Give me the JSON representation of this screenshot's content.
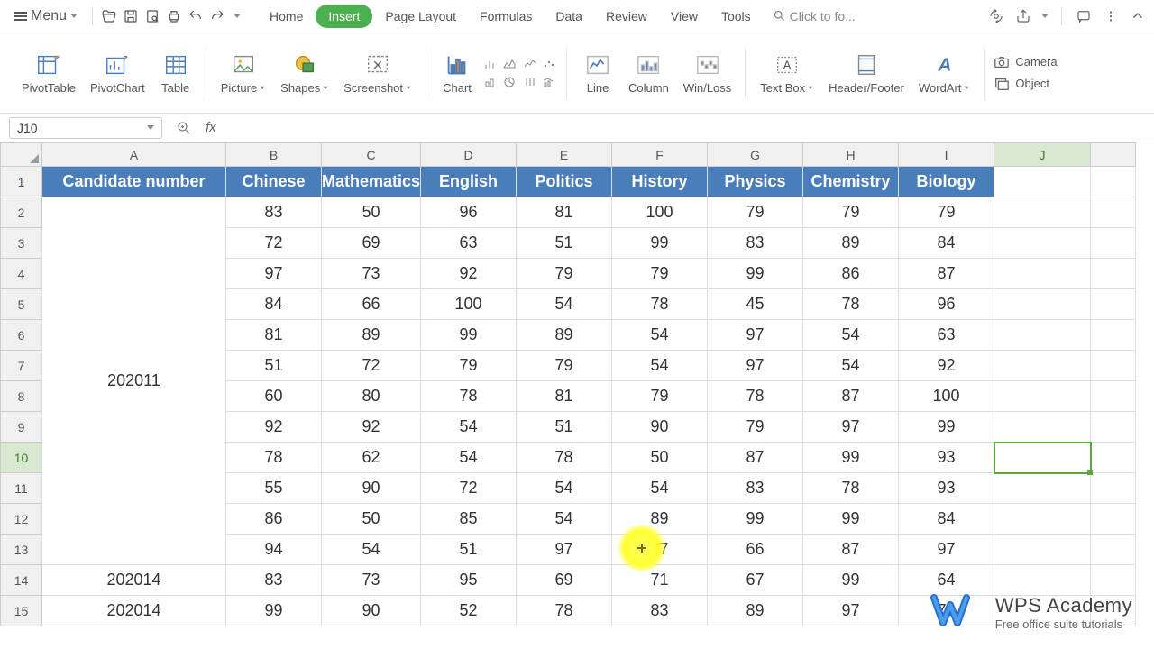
{
  "menu": {
    "label": "Menu"
  },
  "tabs": [
    "Home",
    "Insert",
    "Page Layout",
    "Formulas",
    "Data",
    "Review",
    "View",
    "Tools"
  ],
  "active_tab_index": 1,
  "search_placeholder": "Click to fo...",
  "ribbon": {
    "pivottable": "PivotTable",
    "pivotchart": "PivotChart",
    "table": "Table",
    "picture": "Picture",
    "shapes": "Shapes",
    "screenshot": "Screenshot",
    "chart": "Chart",
    "line": "Line",
    "column": "Column",
    "winloss": "Win/Loss",
    "textbox": "Text Box",
    "headerfooter": "Header/Footer",
    "wordart": "WordArt",
    "camera": "Camera",
    "object": "Object"
  },
  "namebox": "J10",
  "formula": "",
  "columns": [
    "A",
    "B",
    "C",
    "D",
    "E",
    "F",
    "G",
    "H",
    "I",
    "J",
    ""
  ],
  "headers": [
    "Candidate number",
    "Chinese",
    "Mathematics",
    "English",
    "Politics",
    "History",
    "Physics",
    "Chemistry",
    "Biology"
  ],
  "merged_candidate": "202011",
  "rows": [
    [
      "",
      "83",
      "50",
      "96",
      "81",
      "100",
      "79",
      "79",
      "79"
    ],
    [
      "",
      "72",
      "69",
      "63",
      "51",
      "99",
      "83",
      "89",
      "84"
    ],
    [
      "",
      "97",
      "73",
      "92",
      "79",
      "79",
      "99",
      "86",
      "87"
    ],
    [
      "",
      "84",
      "66",
      "100",
      "54",
      "78",
      "45",
      "78",
      "96"
    ],
    [
      "",
      "81",
      "89",
      "99",
      "89",
      "54",
      "97",
      "54",
      "63"
    ],
    [
      "",
      "51",
      "72",
      "79",
      "79",
      "54",
      "97",
      "54",
      "92"
    ],
    [
      "",
      "60",
      "80",
      "78",
      "81",
      "79",
      "78",
      "87",
      "100"
    ],
    [
      "",
      "92",
      "92",
      "54",
      "51",
      "90",
      "79",
      "97",
      "99"
    ],
    [
      "",
      "78",
      "62",
      "54",
      "78",
      "50",
      "87",
      "99",
      "93"
    ],
    [
      "",
      "55",
      "90",
      "72",
      "54",
      "54",
      "83",
      "78",
      "93"
    ],
    [
      "",
      "86",
      "50",
      "85",
      "54",
      "89",
      "99",
      "99",
      "84"
    ],
    [
      "",
      "94",
      "54",
      "51",
      "97",
      "97",
      "66",
      "87",
      "97"
    ],
    [
      "202014",
      "83",
      "73",
      "95",
      "69",
      "71",
      "67",
      "99",
      "64"
    ],
    [
      "202014",
      "99",
      "90",
      "52",
      "78",
      "83",
      "89",
      "97",
      "78"
    ]
  ],
  "row_labels": [
    "1",
    "2",
    "3",
    "4",
    "5",
    "6",
    "7",
    "8",
    "9",
    "10",
    "11",
    "12",
    "13",
    "14",
    "15"
  ],
  "selected": {
    "row": 10,
    "col": "J"
  },
  "watermark": {
    "title": "WPS Academy",
    "subtitle": "Free office suite tutorials"
  },
  "chart_data": {
    "type": "table",
    "title": "",
    "columns": [
      "Candidate number",
      "Chinese",
      "Mathematics",
      "English",
      "Politics",
      "History",
      "Physics",
      "Chemistry",
      "Biology"
    ],
    "records": [
      {
        "Candidate number": "202011",
        "Chinese": 83,
        "Mathematics": 50,
        "English": 96,
        "Politics": 81,
        "History": 100,
        "Physics": 79,
        "Chemistry": 79,
        "Biology": 79
      },
      {
        "Candidate number": "202011",
        "Chinese": 72,
        "Mathematics": 69,
        "English": 63,
        "Politics": 51,
        "History": 99,
        "Physics": 83,
        "Chemistry": 89,
        "Biology": 84
      },
      {
        "Candidate number": "202011",
        "Chinese": 97,
        "Mathematics": 73,
        "English": 92,
        "Politics": 79,
        "History": 79,
        "Physics": 99,
        "Chemistry": 86,
        "Biology": 87
      },
      {
        "Candidate number": "202011",
        "Chinese": 84,
        "Mathematics": 66,
        "English": 100,
        "Politics": 54,
        "History": 78,
        "Physics": 45,
        "Chemistry": 78,
        "Biology": 96
      },
      {
        "Candidate number": "202011",
        "Chinese": 81,
        "Mathematics": 89,
        "English": 99,
        "Politics": 89,
        "History": 54,
        "Physics": 97,
        "Chemistry": 54,
        "Biology": 63
      },
      {
        "Candidate number": "202011",
        "Chinese": 51,
        "Mathematics": 72,
        "English": 79,
        "Politics": 79,
        "History": 54,
        "Physics": 97,
        "Chemistry": 54,
        "Biology": 92
      },
      {
        "Candidate number": "202011",
        "Chinese": 60,
        "Mathematics": 80,
        "English": 78,
        "Politics": 81,
        "History": 79,
        "Physics": 78,
        "Chemistry": 87,
        "Biology": 100
      },
      {
        "Candidate number": "202011",
        "Chinese": 92,
        "Mathematics": 92,
        "English": 54,
        "Politics": 51,
        "History": 90,
        "Physics": 79,
        "Chemistry": 97,
        "Biology": 99
      },
      {
        "Candidate number": "202011",
        "Chinese": 78,
        "Mathematics": 62,
        "English": 54,
        "Politics": 78,
        "History": 50,
        "Physics": 87,
        "Chemistry": 99,
        "Biology": 93
      },
      {
        "Candidate number": "202011",
        "Chinese": 55,
        "Mathematics": 90,
        "English": 72,
        "Politics": 54,
        "History": 54,
        "Physics": 83,
        "Chemistry": 78,
        "Biology": 93
      },
      {
        "Candidate number": "202011",
        "Chinese": 86,
        "Mathematics": 50,
        "English": 85,
        "Politics": 54,
        "History": 89,
        "Physics": 99,
        "Chemistry": 99,
        "Biology": 84
      },
      {
        "Candidate number": "202011",
        "Chinese": 94,
        "Mathematics": 54,
        "English": 51,
        "Politics": 97,
        "History": 97,
        "Physics": 66,
        "Chemistry": 87,
        "Biology": 97
      },
      {
        "Candidate number": "202014",
        "Chinese": 83,
        "Mathematics": 73,
        "English": 95,
        "Politics": 69,
        "History": 71,
        "Physics": 67,
        "Chemistry": 99,
        "Biology": 64
      },
      {
        "Candidate number": "202014",
        "Chinese": 99,
        "Mathematics": 90,
        "English": 52,
        "Politics": 78,
        "History": 83,
        "Physics": 89,
        "Chemistry": 97,
        "Biology": 78
      }
    ]
  }
}
